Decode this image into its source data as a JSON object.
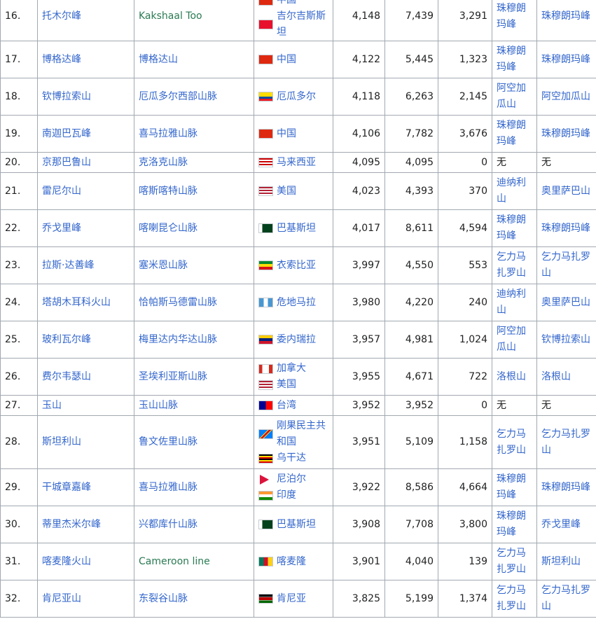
{
  "rows": [
    {
      "rank": "16.",
      "name": "托木尔峰",
      "range": "Kakshaal Too",
      "range_green": true,
      "countries": [
        {
          "flag": "cn",
          "name": "中国"
        },
        {
          "flag": "kg",
          "name": "吉尔吉斯斯坦"
        }
      ],
      "elev": "4,148",
      "parent_elev": "7,439",
      "prom": "3,291",
      "parent": "珠穆朗玛峰",
      "isolation": "珠穆朗玛峰",
      "size": "r1"
    },
    {
      "rank": "17.",
      "name": "博格达峰",
      "range": "博格达山",
      "countries": [
        {
          "flag": "cn",
          "name": "中国"
        }
      ],
      "elev": "4,122",
      "parent_elev": "5,445",
      "prom": "1,323",
      "parent": "珠穆朗玛峰",
      "isolation": "珠穆朗玛峰",
      "size": "r2"
    },
    {
      "rank": "18.",
      "name": "钦博拉索山",
      "range": "厄瓜多尔西部山脉",
      "countries": [
        {
          "flag": "ec",
          "name": "厄瓜多尔"
        }
      ],
      "elev": "4,118",
      "parent_elev": "6,263",
      "prom": "2,145",
      "parent": "阿空加瓜山",
      "isolation": "阿空加瓜山",
      "size": "r2"
    },
    {
      "rank": "19.",
      "name": "南迦巴瓦峰",
      "range": "喜马拉雅山脉",
      "countries": [
        {
          "flag": "cn",
          "name": "中国"
        }
      ],
      "elev": "4,106",
      "parent_elev": "7,782",
      "prom": "3,676",
      "parent": "珠穆朗玛峰",
      "isolation": "珠穆朗玛峰",
      "size": "r2"
    },
    {
      "rank": "20.",
      "name": "京那巴鲁山",
      "range": "克洛克山脉",
      "countries": [
        {
          "flag": "my",
          "name": "马来西亚"
        }
      ],
      "elev": "4,095",
      "parent_elev": "4,095",
      "prom": "0",
      "parent": "无",
      "isolation": "无",
      "plain": true,
      "size": "r3"
    },
    {
      "rank": "21.",
      "name": "雷尼尔山",
      "range": "喀斯喀特山脉",
      "countries": [
        {
          "flag": "us",
          "name": "美国"
        }
      ],
      "elev": "4,023",
      "parent_elev": "4,393",
      "prom": "370",
      "parent": "迪纳利山",
      "isolation": "奥里萨巴山",
      "size": "r2"
    },
    {
      "rank": "22.",
      "name": "乔戈里峰",
      "range": "喀喇昆仑山脉",
      "countries": [
        {
          "flag": "pk",
          "name": "巴基斯坦"
        }
      ],
      "elev": "4,017",
      "parent_elev": "8,611",
      "prom": "4,594",
      "parent": "珠穆朗玛峰",
      "isolation": "珠穆朗玛峰",
      "size": "r2"
    },
    {
      "rank": "23.",
      "name": "拉斯·达善峰",
      "range": "塞米恩山脉",
      "countries": [
        {
          "flag": "et",
          "name": "衣索比亚"
        }
      ],
      "elev": "3,997",
      "parent_elev": "4,550",
      "prom": "553",
      "parent": "乞力马扎罗山",
      "isolation": "乞力马扎罗山",
      "size": "r2"
    },
    {
      "rank": "24.",
      "name": "塔胡木耳科火山",
      "range": "恰帕斯马德雷山脉",
      "countries": [
        {
          "flag": "gt",
          "name": "危地马拉"
        }
      ],
      "elev": "3,980",
      "parent_elev": "4,220",
      "prom": "240",
      "parent": "迪纳利山",
      "isolation": "奥里萨巴山",
      "size": "r2"
    },
    {
      "rank": "25.",
      "name": "玻利瓦尔峰",
      "range": "梅里达内华达山脉",
      "countries": [
        {
          "flag": "ve",
          "name": "委内瑞拉"
        }
      ],
      "elev": "3,957",
      "parent_elev": "4,981",
      "prom": "1,024",
      "parent": "阿空加瓜山",
      "isolation": "钦博拉索山",
      "size": "r2"
    },
    {
      "rank": "26.",
      "name": "费尔韦瑟山",
      "range": "圣埃利亚斯山脉",
      "countries": [
        {
          "flag": "ca",
          "name": "加拿大"
        },
        {
          "flag": "us",
          "name": "美国"
        }
      ],
      "elev": "3,955",
      "parent_elev": "4,671",
      "prom": "722",
      "parent": "洛根山",
      "isolation": "洛根山",
      "size": "r2"
    },
    {
      "rank": "27.",
      "name": "玉山",
      "range": "玉山山脉",
      "countries": [
        {
          "flag": "tw",
          "name": "台湾"
        }
      ],
      "elev": "3,952",
      "parent_elev": "3,952",
      "prom": "0",
      "parent": "无",
      "isolation": "无",
      "plain": true,
      "size": "r3"
    },
    {
      "rank": "28.",
      "name": "斯坦利山",
      "range": "鲁文佐里山脉",
      "countries": [
        {
          "flag": "cd",
          "name": "刚果民主共和国"
        },
        {
          "flag": "ug",
          "name": "乌干达"
        }
      ],
      "elev": "3,951",
      "parent_elev": "5,109",
      "prom": "1,158",
      "parent": "乞力马扎罗山",
      "isolation": "乞力马扎罗山",
      "size": "r1b"
    },
    {
      "rank": "29.",
      "name": "干城章嘉峰",
      "range": "喜马拉雅山脉",
      "countries": [
        {
          "flag": "np",
          "name": "尼泊尔"
        },
        {
          "flag": "in",
          "name": "印度"
        }
      ],
      "elev": "3,922",
      "parent_elev": "8,586",
      "prom": "4,664",
      "parent": "珠穆朗玛峰",
      "isolation": "珠穆朗玛峰",
      "size": "r2"
    },
    {
      "rank": "30.",
      "name": "蒂里杰米尔峰",
      "range": "兴都库什山脉",
      "countries": [
        {
          "flag": "pk",
          "name": "巴基斯坦"
        }
      ],
      "elev": "3,908",
      "parent_elev": "7,708",
      "prom": "3,800",
      "parent": "珠穆朗玛峰",
      "isolation": "乔戈里峰",
      "size": "r2"
    },
    {
      "rank": "31.",
      "name": "喀麦隆火山",
      "range": "Cameroon line",
      "range_green": true,
      "countries": [
        {
          "flag": "cm",
          "name": "喀麦隆"
        }
      ],
      "elev": "3,901",
      "parent_elev": "4,040",
      "prom": "139",
      "parent": "乞力马扎罗山",
      "isolation": "斯坦利山",
      "size": "r2"
    },
    {
      "rank": "32.",
      "name": "肯尼亚山",
      "range": "东裂谷山脉",
      "countries": [
        {
          "flag": "ke",
          "name": "肯尼亚"
        }
      ],
      "elev": "3,825",
      "parent_elev": "5,199",
      "prom": "1,374",
      "parent": "乞力马扎罗山",
      "isolation": "乞力马扎罗山",
      "size": "r2"
    }
  ],
  "flag_colors": {
    "cn": "#de2910",
    "kg": "#e8112d",
    "ec": "#ffdd00",
    "my": "#cc0001",
    "us": "#b22234",
    "pk": "#01411c",
    "et": "#078930",
    "gt": "#4997d0",
    "ve": "#ffcc00",
    "ca": "#d52b1e",
    "tw": "#fe0000",
    "cd": "#007fff",
    "ug": "#fcdc04",
    "np": "#dc143c",
    "in": "#ff9933",
    "cm": "#007a5e",
    "ke": "#006600"
  }
}
